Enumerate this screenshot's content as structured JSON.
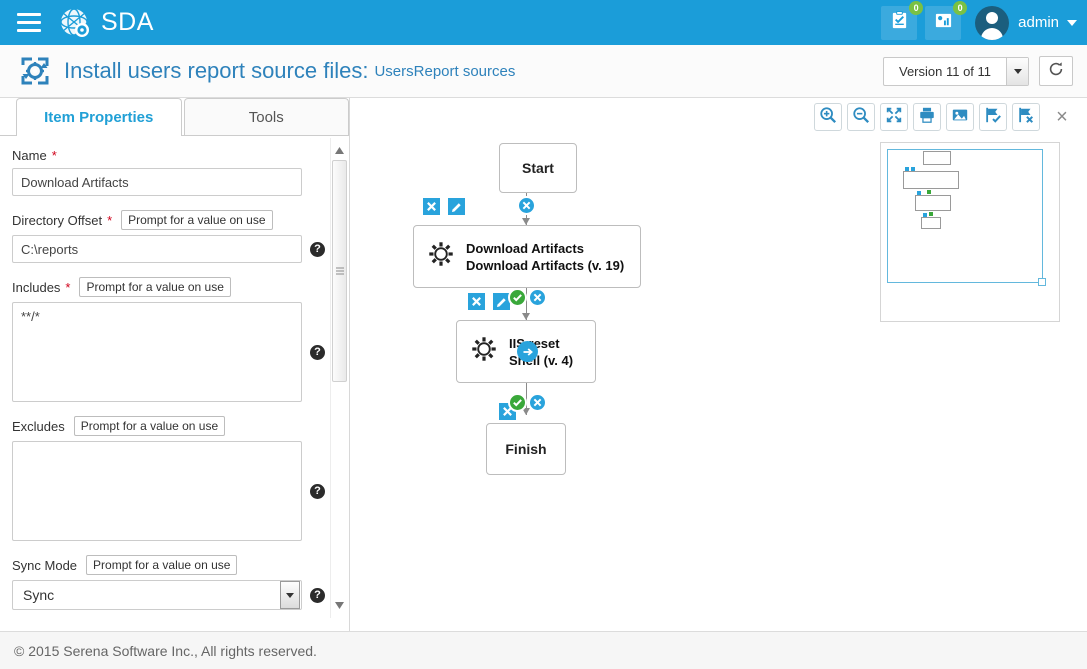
{
  "topbar": {
    "menu_icon": "hamburger-icon",
    "brand_icon": "globe-gear-logo-icon",
    "brand_name": "SDA",
    "approvals_icon": "clipboard-check-icon",
    "approvals_badge": "0",
    "reports_icon": "report-chart-icon",
    "reports_badge": "0",
    "avatar_icon": "user-avatar-icon",
    "username": "admin",
    "caret_icon": "chevron-down-icon",
    "bg_color": "#1b9dd9"
  },
  "subheader": {
    "icon": "deploy-process-icon",
    "title": "Install users report source files:",
    "subtitle": "UsersReport sources",
    "version_label": "Version 11 of 11",
    "version_caret_icon": "chevron-down-icon",
    "refresh_icon": "refresh-icon",
    "title_color": "#2e82bb"
  },
  "left_panel": {
    "tabs": [
      {
        "label": "Item Properties",
        "active": true
      },
      {
        "label": "Tools",
        "active": false
      }
    ],
    "fields": {
      "name": {
        "label": "Name",
        "required": "*",
        "value": "Download Artifacts"
      },
      "directory_offset": {
        "label": "Directory Offset",
        "required": "*",
        "prompt_chip": "Prompt for a value on use",
        "value": "C:\\reports",
        "help_icon": "help-icon"
      },
      "includes": {
        "label": "Includes",
        "required": "*",
        "prompt_chip": "Prompt for a value on use",
        "value": "**/*",
        "help_icon": "help-icon"
      },
      "excludes": {
        "label": "Excludes",
        "prompt_chip": "Prompt for a value on use",
        "value": "",
        "help_icon": "help-icon"
      },
      "sync_mode": {
        "label": "Sync Mode",
        "prompt_chip": "Prompt for a value on use",
        "value": "Sync",
        "caret_icon": "chevron-down-icon",
        "help_icon": "help-icon"
      }
    },
    "scrollbar": {
      "up_icon": "scroll-up-arrow-icon",
      "down_icon": "scroll-down-arrow-icon"
    }
  },
  "canvas": {
    "toolbar": [
      {
        "name": "zoom-in-icon",
        "title": "Zoom In"
      },
      {
        "name": "zoom-out-icon",
        "title": "Zoom Out"
      },
      {
        "name": "fit-to-screen-icon",
        "title": "Fit"
      },
      {
        "name": "print-icon",
        "title": "Print"
      },
      {
        "name": "export-image-icon",
        "title": "Export Image"
      },
      {
        "name": "save-flag-icon",
        "title": "Save"
      },
      {
        "name": "discard-flag-icon",
        "title": "Discard"
      }
    ],
    "close_icon": "close-icon",
    "nodes": [
      {
        "id": "start",
        "label": "Start",
        "type": "terminal"
      },
      {
        "id": "download-artifacts",
        "type": "task",
        "icon": "gear-icon",
        "line1": "Download Artifacts",
        "line2": "Download Artifacts (v. 19)"
      },
      {
        "id": "iis-reset",
        "type": "task",
        "icon": "gear-icon",
        "line1": "IIS reset",
        "line2": "Shell (v. 4)",
        "badge_icon": "arrow-right-icon"
      },
      {
        "id": "finish",
        "label": "Finish",
        "type": "terminal"
      }
    ],
    "node_controls": {
      "delete_icon": "delete-x-icon",
      "edit_icon": "edit-pencil-icon",
      "add_icon": "add-step-x-icon",
      "ok_icon": "check-circle-icon"
    },
    "minimap": {
      "name": "minimap",
      "resize_handle": "minimap-resize-handle"
    }
  },
  "footer": {
    "text": "© 2015 Serena Software Inc., All rights reserved."
  }
}
